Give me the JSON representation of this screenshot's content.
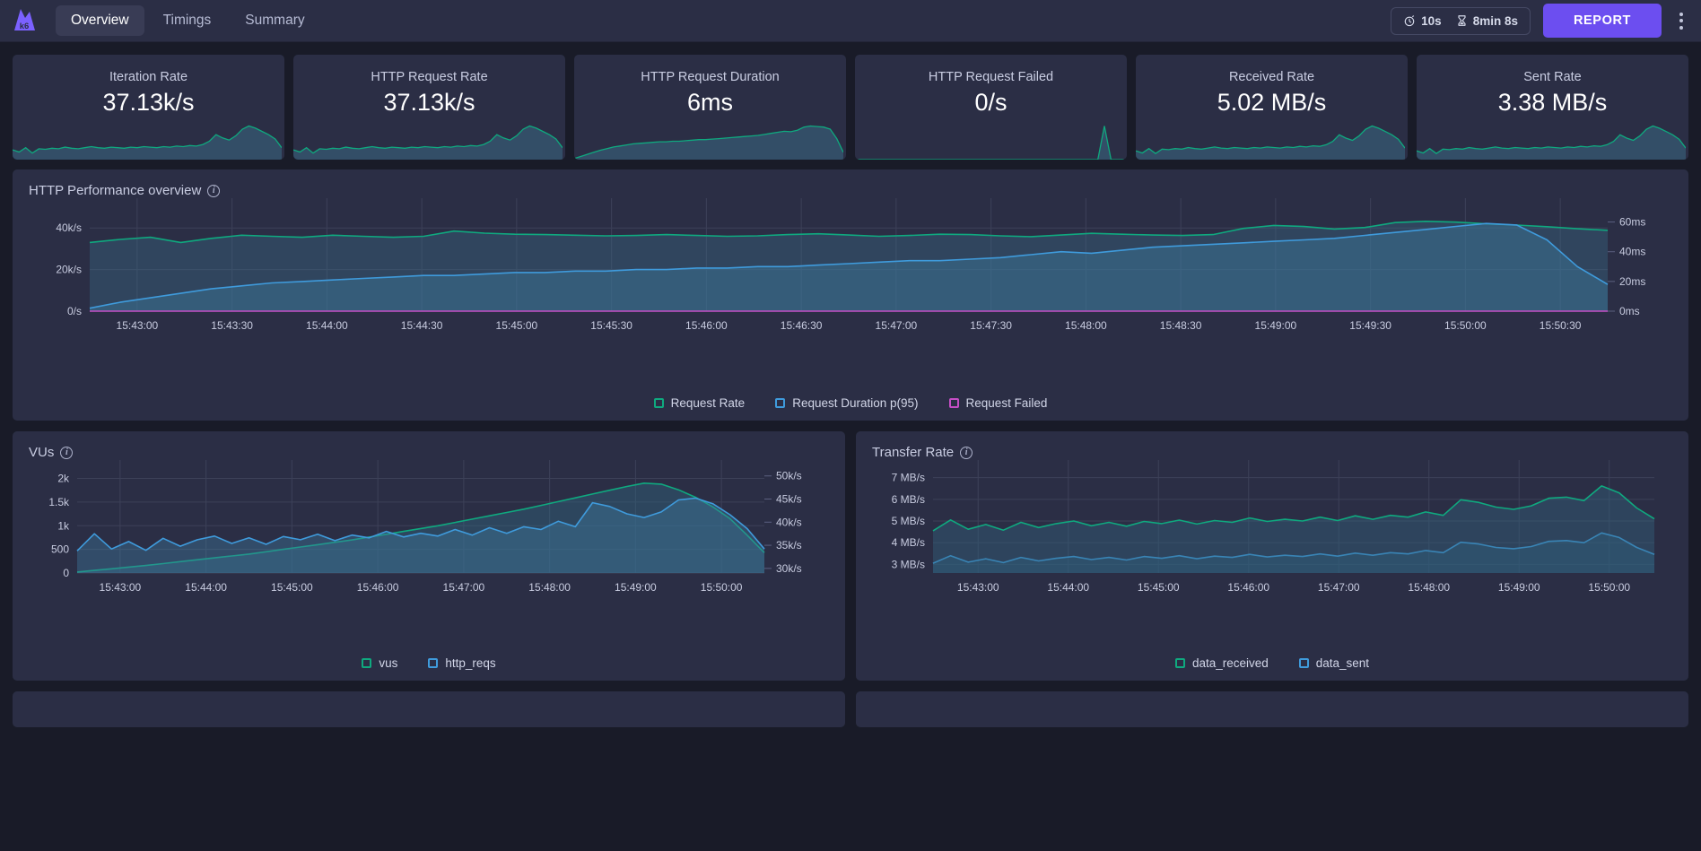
{
  "header": {
    "logo_icon": "k6-logo-icon",
    "tabs": [
      {
        "label": "Overview",
        "active": true
      },
      {
        "label": "Timings",
        "active": false
      },
      {
        "label": "Summary",
        "active": false
      }
    ],
    "refresh_interval": "10s",
    "refresh_icon": "stopwatch-icon",
    "elapsed": "8min 8s",
    "elapsed_icon": "hourglass-icon",
    "report_label": "REPORT",
    "menu_icon": "kebab-menu-icon"
  },
  "colors": {
    "accent": "#6c4ef0",
    "panel_bg": "#2b2e45",
    "page_bg": "#191b28",
    "teal": "#0fa97f",
    "blue": "#3f9bdc",
    "magenta": "#c64ec6"
  },
  "stats": [
    {
      "title": "Iteration Rate",
      "value": "37.13k/s",
      "spark": [
        18,
        14,
        22,
        12,
        20,
        19,
        21,
        20,
        23,
        21,
        20,
        22,
        24,
        22,
        21,
        23,
        22,
        21,
        23,
        22,
        24,
        23,
        22,
        24,
        23,
        25,
        24,
        26,
        25,
        28,
        34,
        46,
        40,
        36,
        44,
        56,
        62,
        58,
        52,
        46,
        38,
        22
      ]
    },
    {
      "title": "HTTP Request Rate",
      "value": "37.13k/s",
      "spark": [
        18,
        14,
        22,
        12,
        20,
        19,
        21,
        20,
        23,
        21,
        20,
        22,
        24,
        22,
        21,
        23,
        22,
        21,
        23,
        22,
        24,
        23,
        22,
        24,
        23,
        25,
        24,
        26,
        25,
        28,
        34,
        46,
        40,
        36,
        44,
        56,
        62,
        58,
        52,
        46,
        38,
        22
      ]
    },
    {
      "title": "HTTP Request Duration",
      "value": "6ms",
      "spark": [
        2,
        6,
        10,
        14,
        18,
        21,
        24,
        26,
        28,
        30,
        31,
        32,
        33,
        34,
        34,
        35,
        35,
        36,
        37,
        38,
        38,
        39,
        40,
        41,
        42,
        43,
        44,
        45,
        46,
        48,
        50,
        52,
        54,
        53,
        56,
        62,
        64,
        63,
        62,
        58,
        40,
        14
      ]
    },
    {
      "title": "HTTP Request Failed",
      "value": "0/s",
      "spark": [
        0,
        0,
        0,
        0,
        0,
        0,
        0,
        0,
        0,
        0,
        0,
        0,
        0,
        0,
        0,
        0,
        0,
        0,
        0,
        0,
        0,
        0,
        0,
        0,
        0,
        0,
        0,
        0,
        0,
        0,
        0,
        0,
        0,
        0,
        0,
        0,
        0,
        0,
        58,
        0,
        0,
        0
      ]
    },
    {
      "title": "Received Rate",
      "value": "5.02 MB/s",
      "spark": [
        16,
        12,
        20,
        11,
        19,
        18,
        20,
        19,
        22,
        20,
        19,
        21,
        23,
        21,
        20,
        22,
        21,
        20,
        22,
        21,
        23,
        22,
        21,
        23,
        22,
        24,
        23,
        25,
        24,
        27,
        33,
        45,
        39,
        35,
        43,
        55,
        61,
        57,
        51,
        45,
        37,
        21
      ]
    },
    {
      "title": "Sent Rate",
      "value": "3.38 MB/s",
      "spark": [
        16,
        12,
        20,
        11,
        19,
        18,
        20,
        19,
        22,
        20,
        19,
        21,
        23,
        21,
        20,
        22,
        21,
        20,
        22,
        21,
        23,
        22,
        21,
        23,
        22,
        24,
        23,
        25,
        24,
        27,
        33,
        45,
        39,
        35,
        43,
        55,
        61,
        57,
        51,
        45,
        37,
        21
      ]
    }
  ],
  "panels": {
    "http_overview": {
      "title": "HTTP Performance overview",
      "info_icon": "info-icon"
    },
    "vus": {
      "title": "VUs",
      "info_icon": "info-icon"
    },
    "transfer": {
      "title": "Transfer Rate",
      "info_icon": "info-icon"
    }
  },
  "chart_data": [
    {
      "type": "area",
      "id": "http-performance-overview",
      "title": "HTTP Performance overview",
      "xlabel": "",
      "ylabel": "",
      "grid": true,
      "legend_position": "bottom",
      "x": [
        "15:43:00",
        "15:43:30",
        "15:44:00",
        "15:44:30",
        "15:45:00",
        "15:45:30",
        "15:46:00",
        "15:46:30",
        "15:47:00",
        "15:47:30",
        "15:48:00",
        "15:48:30",
        "15:49:00",
        "15:49:30",
        "15:50:00",
        "15:50:30"
      ],
      "xtick_labels": [
        "15:43:00",
        "15:43:30",
        "15:44:00",
        "15:44:30",
        "15:45:00",
        "15:45:30",
        "15:46:00",
        "15:46:30",
        "15:47:00",
        "15:47:30",
        "15:48:00",
        "15:48:30",
        "15:49:00",
        "15:49:30",
        "15:50:00",
        "15:50:30"
      ],
      "y_left": {
        "label": "",
        "ticks": [
          "0/s",
          "20k/s",
          "40k/s"
        ],
        "values": [
          0,
          20000,
          40000
        ],
        "min": 0,
        "max": 50000
      },
      "y_right": {
        "label": "",
        "ticks": [
          "0ms",
          "20ms",
          "40ms",
          "60ms"
        ],
        "values": [
          0,
          20,
          40,
          60
        ],
        "min": 0,
        "max": 70
      },
      "series": [
        {
          "name": "Request Rate",
          "color": "#0fa97f",
          "axis": "left",
          "values": [
            33000,
            34500,
            35500,
            33000,
            35000,
            36500,
            36000,
            35500,
            36500,
            36000,
            35500,
            36000,
            38500,
            37500,
            37000,
            36800,
            36500,
            36200,
            36400,
            36800,
            36400,
            36000,
            36200,
            36800,
            37200,
            36600,
            36000,
            36400,
            37000,
            36800,
            36200,
            35800,
            36600,
            37400,
            37000,
            36600,
            36400,
            36800,
            39800,
            41200,
            40700,
            39500,
            40200,
            42600,
            43200,
            42800,
            42000,
            41400,
            40600,
            39600,
            38900
          ]
        },
        {
          "name": "Request Duration p(95)",
          "color": "#3f9bdc",
          "axis": "right",
          "values": [
            2,
            6,
            9,
            12,
            15,
            17,
            19,
            20,
            21,
            22,
            23,
            24,
            24,
            25,
            26,
            26,
            27,
            27,
            28,
            28,
            29,
            29,
            30,
            30,
            31,
            32,
            33,
            34,
            34,
            35,
            36,
            38,
            40,
            39,
            41,
            43,
            44,
            45,
            46,
            47,
            48,
            49,
            51,
            53,
            55,
            57,
            59,
            58,
            48,
            30,
            18
          ]
        },
        {
          "name": "Request Failed",
          "color": "#c64ec6",
          "axis": "left",
          "values": [
            0,
            0,
            0,
            0,
            0,
            0,
            0,
            0,
            0,
            0,
            0,
            0,
            0,
            0,
            0,
            0,
            0,
            0,
            0,
            0,
            0,
            0,
            0,
            0,
            0,
            0,
            0,
            0,
            0,
            0,
            0,
            0,
            0,
            0,
            0,
            0,
            0,
            0,
            0,
            0,
            0,
            0,
            0,
            0,
            0,
            0,
            0,
            0,
            0,
            0,
            0
          ]
        }
      ]
    },
    {
      "type": "area",
      "id": "vus",
      "title": "VUs",
      "xlabel": "",
      "ylabel": "",
      "grid": true,
      "legend_position": "bottom",
      "xtick_labels": [
        "15:43:00",
        "15:44:00",
        "15:45:00",
        "15:46:00",
        "15:47:00",
        "15:48:00",
        "15:49:00",
        "15:50:00"
      ],
      "y_left": {
        "ticks": [
          "0",
          "500",
          "1k",
          "1.5k",
          "2k"
        ],
        "values": [
          0,
          500,
          1000,
          1500,
          2000
        ],
        "min": 0,
        "max": 2200
      },
      "y_right": {
        "ticks": [
          "30k/s",
          "35k/s",
          "40k/s",
          "45k/s",
          "50k/s"
        ],
        "values": [
          30000,
          35000,
          40000,
          45000,
          50000
        ],
        "min": 29000,
        "max": 51500
      },
      "series": [
        {
          "name": "vus",
          "color": "#0fa97f",
          "axis": "left",
          "values": [
            20,
            55,
            90,
            125,
            160,
            200,
            240,
            280,
            320,
            360,
            400,
            450,
            500,
            550,
            600,
            650,
            700,
            760,
            820,
            880,
            940,
            1000,
            1070,
            1140,
            1210,
            1280,
            1350,
            1430,
            1510,
            1590,
            1670,
            1750,
            1830,
            1900,
            1880,
            1760,
            1600,
            1400,
            1150,
            800,
            430
          ]
        },
        {
          "name": "http_reqs",
          "color": "#3f9bdc",
          "axis": "right",
          "values": [
            33800,
            37500,
            34200,
            35800,
            33900,
            36500,
            34800,
            36200,
            37000,
            35400,
            36600,
            35200,
            36900,
            36200,
            37400,
            36000,
            37200,
            36600,
            38000,
            36800,
            37600,
            37000,
            38400,
            37200,
            38800,
            37600,
            39000,
            38400,
            40200,
            39000,
            44200,
            43400,
            41800,
            41000,
            42200,
            44800,
            45200,
            44000,
            41600,
            38600,
            34200
          ]
        }
      ]
    },
    {
      "type": "area",
      "id": "transfer-rate",
      "title": "Transfer Rate",
      "xlabel": "",
      "ylabel": "",
      "grid": true,
      "legend_position": "bottom",
      "xtick_labels": [
        "15:43:00",
        "15:44:00",
        "15:45:00",
        "15:46:00",
        "15:47:00",
        "15:48:00",
        "15:49:00",
        "15:50:00"
      ],
      "y_left": {
        "ticks": [
          "3 MB/s",
          "4 MB/s",
          "5 MB/s",
          "6 MB/s",
          "7 MB/s"
        ],
        "values": [
          3,
          4,
          5,
          6,
          7
        ],
        "min": 2.6,
        "max": 7.4,
        "unit": "MB/s"
      },
      "series": [
        {
          "name": "data_received",
          "color": "#0fa97f",
          "axis": "left",
          "values": [
            4.55,
            5.05,
            4.62,
            4.84,
            4.58,
            4.94,
            4.7,
            4.88,
            5.0,
            4.78,
            4.94,
            4.76,
            4.98,
            4.88,
            5.04,
            4.86,
            5.02,
            4.94,
            5.14,
            4.98,
            5.08,
            5.0,
            5.18,
            5.02,
            5.24,
            5.08,
            5.26,
            5.18,
            5.42,
            5.26,
            5.98,
            5.86,
            5.64,
            5.54,
            5.7,
            6.05,
            6.1,
            5.94,
            6.62,
            6.3,
            5.6,
            5.1
          ]
        },
        {
          "name": "data_sent",
          "color": "#3f9bdc",
          "axis": "left",
          "values": [
            3.05,
            3.4,
            3.1,
            3.26,
            3.08,
            3.32,
            3.16,
            3.28,
            3.36,
            3.22,
            3.32,
            3.2,
            3.36,
            3.28,
            3.4,
            3.26,
            3.38,
            3.32,
            3.46,
            3.34,
            3.42,
            3.36,
            3.48,
            3.38,
            3.52,
            3.42,
            3.54,
            3.48,
            3.64,
            3.54,
            4.02,
            3.94,
            3.78,
            3.72,
            3.82,
            4.06,
            4.1,
            4.0,
            4.45,
            4.24,
            3.78,
            3.46
          ]
        }
      ]
    }
  ],
  "legends": {
    "http_overview": [
      {
        "label": "Request Rate",
        "color": "#0fa97f"
      },
      {
        "label": "Request Duration p(95)",
        "color": "#3f9bdc"
      },
      {
        "label": "Request Failed",
        "color": "#c64ec6"
      }
    ],
    "vus": [
      {
        "label": "vus",
        "color": "#0fa97f"
      },
      {
        "label": "http_reqs",
        "color": "#3f9bdc"
      }
    ],
    "transfer": [
      {
        "label": "data_received",
        "color": "#0fa97f"
      },
      {
        "label": "data_sent",
        "color": "#3f9bdc"
      }
    ]
  }
}
